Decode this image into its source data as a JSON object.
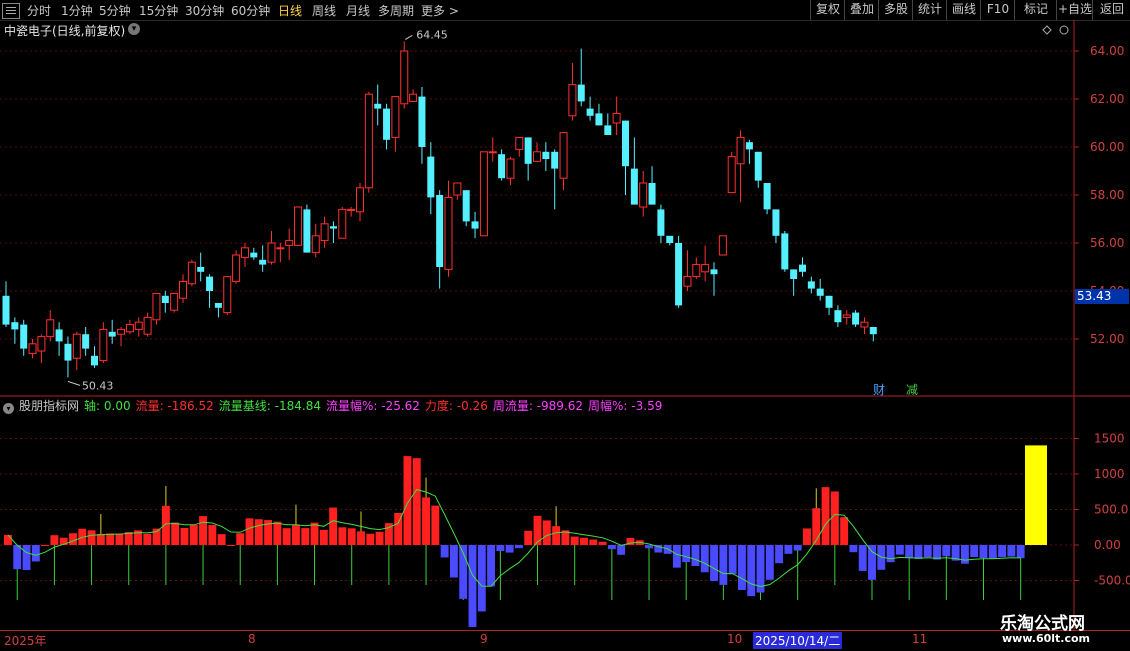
{
  "toolbar": {
    "periods": [
      "分时",
      "1分钟",
      "5分钟",
      "15分钟",
      "30分钟",
      "60分钟",
      "日线",
      "周线",
      "月线",
      "多周期",
      "更多 >"
    ],
    "active_period": "日线",
    "right_buttons": [
      "复权",
      "叠加",
      "多股",
      "统计",
      "画线",
      "F10",
      "标记",
      "+自选",
      "返回"
    ]
  },
  "chart": {
    "title": "中瓷电子(日线,前复权)",
    "high_label": "64.45",
    "low_label": "50.43",
    "price_ticks": [
      "64.00",
      "62.00",
      "60.00",
      "58.00",
      "56.00",
      "54.00",
      "52.00"
    ],
    "current_price": "53.43",
    "tag_cai": "财",
    "tag_jian": "减"
  },
  "indicator": {
    "name": "股朋指标网",
    "items": [
      {
        "label": "轴: 0.00",
        "color": "#40e040"
      },
      {
        "label": "流量: -186.52",
        "color": "#ff3030"
      },
      {
        "label": "流量基线: -184.84",
        "color": "#40e040"
      },
      {
        "label": "流量幅%: -25.62",
        "color": "#ff40ff"
      },
      {
        "label": "力度: -0.26",
        "color": "#ff3030"
      },
      {
        "label": "周流量: -989.62",
        "color": "#ff40ff"
      },
      {
        "label": "周幅%: -3.59",
        "color": "#ff40ff"
      }
    ],
    "ticks": [
      "1500",
      "1000",
      "500.0",
      "0.00",
      "-500.0"
    ]
  },
  "dates": {
    "year": "2025年",
    "months": [
      "8",
      "9",
      "10",
      "11"
    ],
    "selected": "2025/10/14/二"
  },
  "watermark": {
    "line1": "乐淘公式网",
    "line2": "www.60lt.com"
  },
  "chart_data": {
    "type": "candlestick",
    "candles": [
      [
        53.8,
        52.6,
        54.4,
        52.5
      ],
      [
        52.7,
        52.4,
        52.9,
        51.8
      ],
      [
        52.6,
        51.6,
        52.8,
        51.3
      ],
      [
        51.4,
        51.8,
        52.0,
        51.2
      ],
      [
        51.5,
        52.1,
        52.2,
        51.0
      ],
      [
        52.1,
        52.8,
        53.2,
        51.9
      ],
      [
        52.4,
        51.9,
        52.7,
        51.3
      ],
      [
        51.8,
        51.1,
        52.1,
        50.4
      ],
      [
        51.2,
        52.2,
        52.3,
        50.7
      ],
      [
        52.2,
        51.6,
        52.5,
        51.3
      ],
      [
        51.3,
        50.9,
        51.7,
        50.8
      ],
      [
        51.1,
        52.4,
        52.7,
        51.0
      ],
      [
        52.3,
        52.1,
        52.8,
        51.8
      ],
      [
        52.2,
        52.4,
        52.5,
        51.7
      ],
      [
        52.3,
        52.6,
        52.8,
        52.2
      ],
      [
        52.4,
        52.7,
        52.9,
        52.1
      ],
      [
        52.2,
        52.9,
        53.1,
        52.1
      ],
      [
        52.8,
        53.9,
        53.9,
        52.6
      ],
      [
        53.8,
        53.5,
        54.0,
        53.1
      ],
      [
        53.2,
        53.9,
        53.9,
        53.1
      ],
      [
        53.7,
        54.4,
        54.7,
        53.5
      ],
      [
        54.3,
        55.2,
        55.3,
        54.2
      ],
      [
        55.0,
        54.8,
        55.6,
        54.4
      ],
      [
        54.6,
        54.0,
        54.7,
        53.3
      ],
      [
        53.5,
        53.3,
        53.5,
        52.9
      ],
      [
        53.1,
        54.6,
        54.6,
        53.0
      ],
      [
        54.4,
        55.5,
        55.7,
        54.3
      ],
      [
        55.4,
        55.8,
        56.0,
        55.0
      ],
      [
        55.6,
        55.4,
        55.8,
        55.3
      ],
      [
        55.3,
        55.1,
        55.9,
        54.8
      ],
      [
        55.2,
        56.0,
        56.5,
        55.1
      ],
      [
        55.8,
        55.8,
        56.0,
        55.2
      ],
      [
        55.9,
        56.1,
        56.6,
        55.3
      ],
      [
        55.9,
        57.5,
        57.5,
        55.9
      ],
      [
        57.4,
        55.6,
        57.6,
        55.6
      ],
      [
        55.6,
        56.3,
        56.8,
        55.4
      ],
      [
        56.1,
        56.8,
        57.1,
        55.8
      ],
      [
        56.7,
        56.6,
        56.9,
        56.0
      ],
      [
        56.2,
        57.4,
        57.5,
        56.2
      ],
      [
        57.4,
        57.4,
        57.5,
        57.1
      ],
      [
        57.3,
        58.3,
        58.5,
        56.9
      ],
      [
        58.3,
        62.2,
        62.3,
        58.1
      ],
      [
        61.8,
        61.6,
        62.6,
        60.9
      ],
      [
        61.6,
        60.3,
        61.8,
        59.9
      ],
      [
        60.4,
        62.1,
        62.1,
        59.8
      ],
      [
        61.8,
        64.0,
        64.4,
        61.6
      ],
      [
        61.9,
        62.2,
        62.4,
        61.9
      ],
      [
        62.1,
        60.0,
        62.5,
        59.3
      ],
      [
        59.6,
        57.9,
        60.2,
        57.2
      ],
      [
        58.0,
        55.0,
        58.2,
        54.1
      ],
      [
        54.9,
        57.9,
        58.6,
        54.6
      ],
      [
        58.0,
        58.5,
        58.5,
        57.8
      ],
      [
        58.2,
        56.9,
        58.2,
        56.7
      ],
      [
        56.9,
        56.6,
        57.3,
        56.2
      ],
      [
        56.3,
        59.8,
        59.8,
        56.3
      ],
      [
        59.8,
        59.8,
        60.4,
        59.4
      ],
      [
        59.7,
        58.7,
        59.9,
        58.6
      ],
      [
        58.7,
        59.5,
        59.6,
        58.4
      ],
      [
        59.9,
        60.4,
        60.4,
        59.6
      ],
      [
        60.4,
        59.3,
        60.4,
        58.6
      ],
      [
        59.4,
        59.8,
        60.2,
        59.4
      ],
      [
        59.8,
        59.5,
        60.2,
        59.0
      ],
      [
        59.8,
        59.1,
        59.9,
        57.4
      ],
      [
        58.7,
        60.6,
        60.6,
        58.2
      ],
      [
        61.3,
        62.6,
        63.5,
        61.1
      ],
      [
        62.6,
        61.9,
        64.1,
        61.7
      ],
      [
        61.6,
        61.3,
        62.1,
        61.1
      ],
      [
        61.4,
        60.9,
        61.8,
        60.9
      ],
      [
        60.9,
        60.5,
        61.4,
        60.5
      ],
      [
        61.0,
        61.4,
        62.1,
        60.5
      ],
      [
        61.1,
        59.2,
        61.1,
        58.0
      ],
      [
        59.1,
        57.6,
        60.4,
        57.6
      ],
      [
        57.5,
        58.5,
        59.0,
        57.1
      ],
      [
        58.5,
        57.6,
        59.2,
        57.6
      ],
      [
        57.4,
        56.3,
        57.6,
        56.0
      ],
      [
        56.3,
        56.0,
        56.2,
        55.9
      ],
      [
        56.0,
        53.4,
        56.3,
        53.3
      ],
      [
        54.2,
        54.6,
        55.7,
        54.0
      ],
      [
        54.6,
        55.1,
        55.4,
        54.5
      ],
      [
        54.8,
        55.1,
        55.9,
        54.4
      ],
      [
        54.9,
        54.7,
        55.2,
        53.8
      ],
      [
        55.5,
        56.3,
        56.3,
        55.5
      ],
      [
        58.1,
        59.6,
        59.8,
        58.2
      ],
      [
        59.3,
        60.4,
        60.7,
        57.7
      ],
      [
        60.2,
        59.9,
        60.3,
        59.3
      ],
      [
        59.8,
        58.6,
        59.8,
        58.3
      ],
      [
        58.5,
        57.4,
        58.5,
        57.2
      ],
      [
        57.4,
        56.3,
        57.4,
        56.0
      ],
      [
        56.4,
        54.9,
        56.5,
        54.8
      ],
      [
        54.9,
        54.5,
        54.9,
        53.8
      ],
      [
        55.1,
        54.8,
        55.4,
        54.6
      ],
      [
        54.4,
        54.1,
        54.6,
        53.9
      ],
      [
        54.1,
        53.8,
        54.5,
        53.6
      ],
      [
        53.8,
        53.3,
        53.8,
        53.0
      ],
      [
        53.2,
        52.7,
        53.4,
        52.5
      ],
      [
        52.9,
        53.0,
        53.2,
        52.6
      ],
      [
        53.1,
        52.6,
        53.2,
        52.5
      ],
      [
        52.5,
        52.7,
        52.9,
        52.2
      ],
      [
        52.5,
        52.2,
        52.4,
        51.9
      ]
    ],
    "candle_order": "open, close, high, low",
    "ylim": [
      50.0,
      65.0
    ],
    "indicator_bars": [
      142,
      -340,
      -353,
      -232,
      0,
      138,
      103,
      166,
      229,
      207,
      156,
      163,
      162,
      183,
      206,
      157,
      231,
      551,
      317,
      240,
      284,
      407,
      282,
      153,
      0,
      166,
      375,
      363,
      351,
      329,
      237,
      287,
      238,
      315,
      213,
      527,
      249,
      235,
      193,
      158,
      187,
      308,
      451,
      1252,
      1223,
      670,
      555,
      -175,
      -458,
      -758,
      -1154,
      -936,
      -584,
      -85,
      -107,
      -45,
      200,
      411,
      346,
      265,
      206,
      119,
      102,
      77,
      46,
      -58,
      -138,
      100,
      66,
      -46,
      -106,
      -125,
      -319,
      -241,
      -295,
      -384,
      -507,
      -562,
      -411,
      -634,
      -720,
      -670,
      -490,
      -256,
      -124,
      -78,
      233,
      518,
      815,
      754,
      392,
      -101,
      -365,
      -490,
      -349,
      -242,
      -135,
      -186,
      -198,
      -170,
      -205,
      -159,
      -220,
      -263,
      -169,
      -183,
      -189,
      -170,
      -163,
      -186,
      1403
    ],
    "indicator_ylim": [
      -1150,
      1900
    ]
  }
}
